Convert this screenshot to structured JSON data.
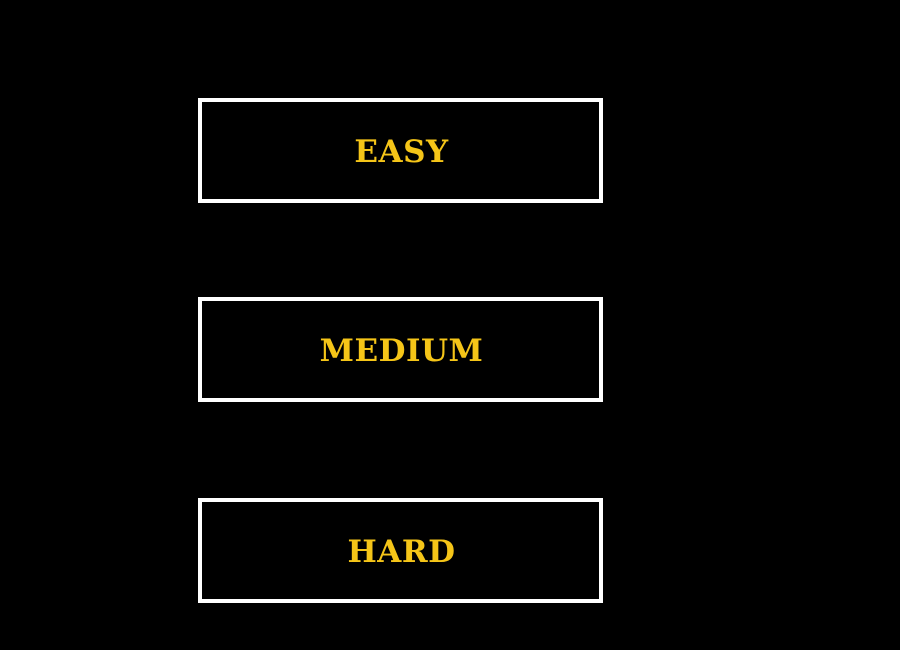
{
  "menu": {
    "buttons": [
      {
        "label": "EASY"
      },
      {
        "label": "MEDIUM"
      },
      {
        "label": "HARD"
      }
    ]
  },
  "colors": {
    "background": "#000000",
    "button_border": "#ffffff",
    "label": "#f5c518"
  }
}
